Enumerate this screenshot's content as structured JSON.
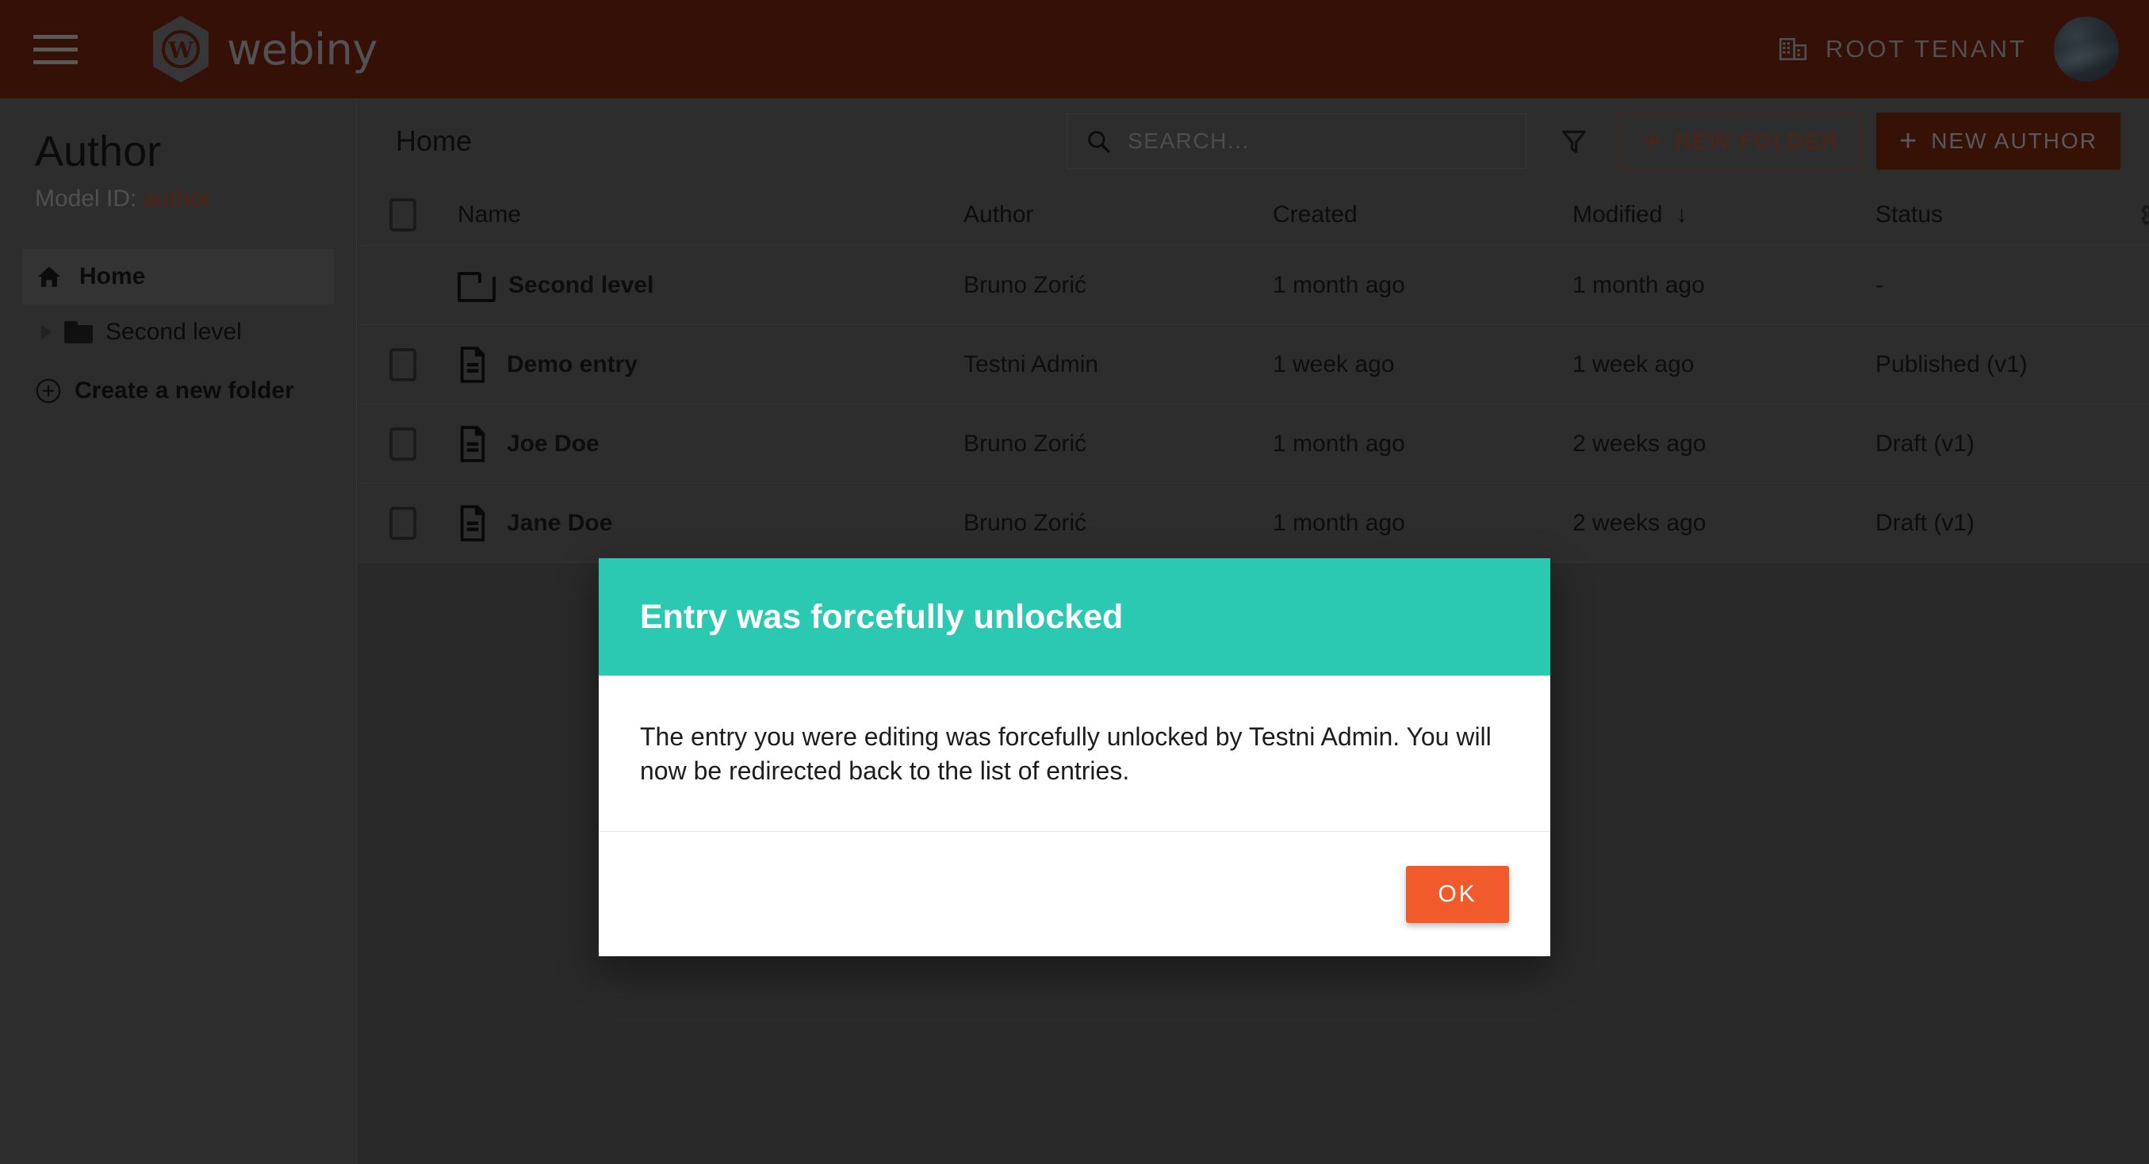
{
  "topbar": {
    "menu_icon": "hamburger-icon",
    "logo_text": "webiny",
    "logo_mark": "webiny-hexagon-w-icon",
    "tenant_icon": "building-icon",
    "tenant_label": "ROOT TENANT",
    "avatar": "user-avatar",
    "bg_color": "#5a1c0d"
  },
  "sidebar": {
    "title": "Author",
    "model_id_label": "Model ID:",
    "model_id_value": "author",
    "model_id_color": "#8c3a22",
    "items": [
      {
        "label": "Home",
        "icon": "home-icon",
        "active": true
      },
      {
        "label": "Second level",
        "icon": "folder-icon",
        "active": false
      }
    ],
    "create_folder_label": "Create a new folder",
    "create_folder_icon": "plus-circle-icon"
  },
  "toolbar": {
    "breadcrumb": "Home",
    "search_placeholder": "SEARCH...",
    "search_value": "",
    "search_icon": "search-icon",
    "filter_icon": "filter-icon",
    "new_folder_label": "NEW FOLDER",
    "new_entry_label": "NEW AUTHOR",
    "accent_color": "#8e3c22",
    "primary_bg": "#5d1e0c"
  },
  "table": {
    "columns": [
      "Name",
      "Author",
      "Created",
      "Modified",
      "Status"
    ],
    "sort_column": "Modified",
    "sort_icon": "arrow-down-icon",
    "settings_icon": "gear-icon",
    "select_all_checked": false,
    "rows": [
      {
        "name": "Second level",
        "icon": "folder-icon",
        "has_checkbox": false,
        "author": "Bruno Zorić",
        "created": "1 month ago",
        "modified": "1 month ago",
        "status": "-"
      },
      {
        "name": "Demo entry",
        "icon": "file-icon",
        "has_checkbox": true,
        "author": "Testni Admin",
        "created": "1 week ago",
        "modified": "1 week ago",
        "status": "Published (v1)"
      },
      {
        "name": "Joe Doe",
        "icon": "file-icon",
        "has_checkbox": true,
        "author": "Bruno Zorić",
        "created": "1 month ago",
        "modified": "2 weeks ago",
        "status": "Draft (v1)"
      },
      {
        "name": "Jane Doe",
        "icon": "file-icon",
        "has_checkbox": true,
        "author": "Bruno Zorić",
        "created": "1 month ago",
        "modified": "2 weeks ago",
        "status": "Draft (v1)"
      }
    ]
  },
  "dialog": {
    "title": "Entry was forcefully unlocked",
    "message": "The entry you were editing was forcefully unlocked by Testni Admin. You will now be redirected back to the list of entries.",
    "ok_label": "OK",
    "header_color": "#2bc9b2",
    "ok_color": "#f15a2b"
  }
}
